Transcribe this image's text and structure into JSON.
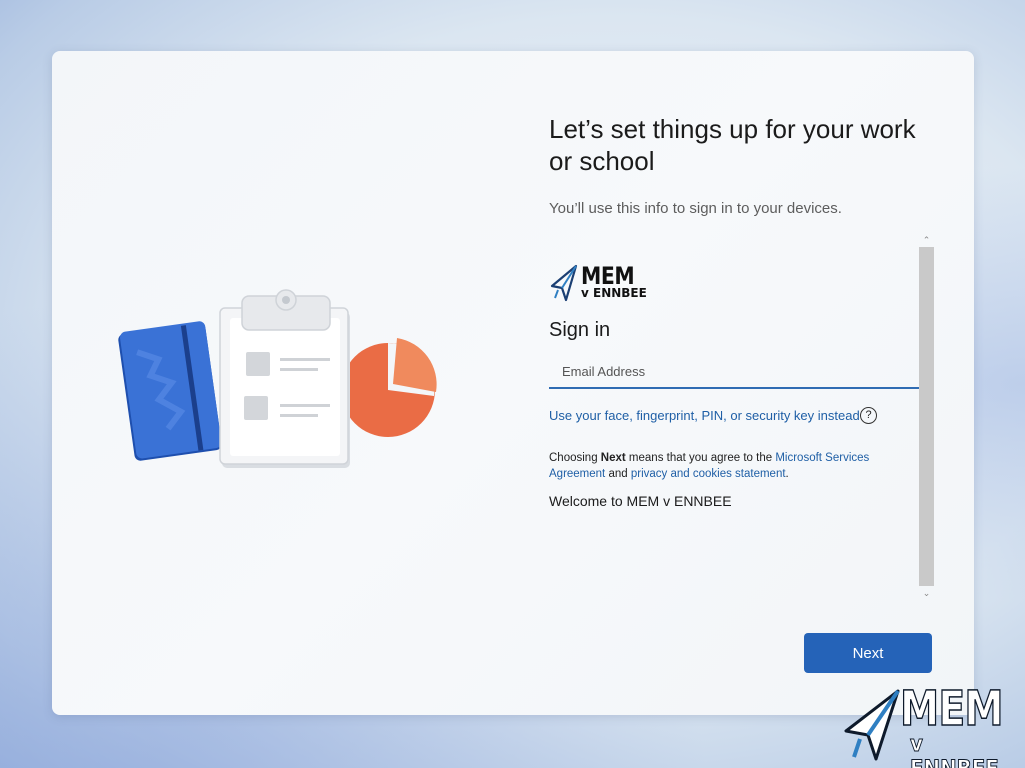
{
  "setup": {
    "title": "Let’s set things up for your work or school",
    "subtitle": "You’ll use this info to sign in to your devices."
  },
  "logo": {
    "line1": "MEM",
    "line2": "v ENNBEE",
    "icon": "paper-plane-icon"
  },
  "signin": {
    "heading": "Sign in",
    "email_placeholder": "Email Address",
    "email_value": "",
    "alt_link": "Use your face, fingerprint, PIN, or security key instead",
    "help_icon": "question-circle-icon",
    "help_glyph": "?"
  },
  "agreement": {
    "prefix": "Choosing ",
    "bold": "Next",
    "middle": " means that you agree to the ",
    "link1": "Microsoft Services Agreement",
    "and": " and ",
    "link2": "privacy and cookies statement",
    "suffix": "."
  },
  "welcome": "Welcome to MEM v ENNBEE",
  "scrollbar": {
    "up_glyph": "⌃",
    "down_glyph": "⌄"
  },
  "next_button": "Next",
  "watermark": {
    "line1": "MEM",
    "line2": "v ENNBEE"
  },
  "colors": {
    "accent": "#2563b8",
    "link": "#1f5fa6",
    "illustration_book": "#2d63c4",
    "illustration_pie": "#ea6c45"
  }
}
